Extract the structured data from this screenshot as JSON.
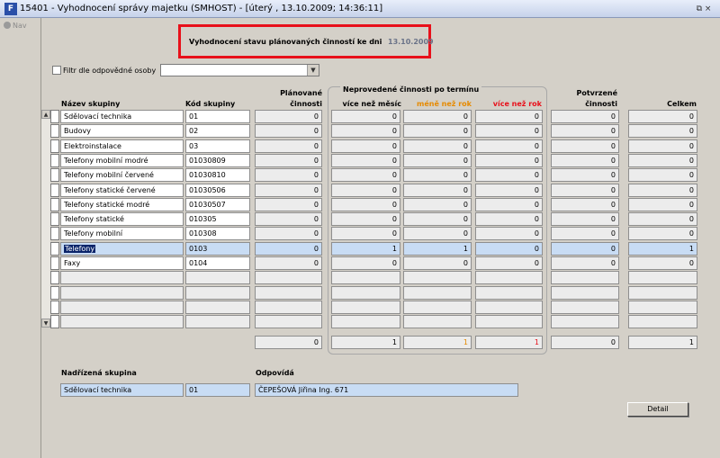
{
  "window": {
    "icon_label": "F",
    "title": "15401 - Vyhodnocení správy majetku (SMHOST) - [úterý , 13.10.2009; 14:36:11]",
    "restore_glyph": "⧉ ×"
  },
  "nav": {
    "label": "Nav"
  },
  "header": {
    "title": "Vyhodnocení stavu plánovaných činností ke dni",
    "date": "13.10.2009"
  },
  "filter": {
    "label": "Filtr dle odpovědné osoby",
    "value": ""
  },
  "columns": {
    "name": "Název skupiny",
    "code": "Kód skupiny",
    "planned_line1": "Plánované",
    "planned_line2": "činnosti",
    "overdue_group": "Neprovedené činnosti po termínu",
    "over_month": "více než měsíc",
    "under_year": "méně než rok",
    "over_year": "více než rok",
    "confirmed_line1": "Potvrzené",
    "confirmed_line2": "činnosti",
    "total": "Celkem"
  },
  "colors": {
    "under_year": "#e68a00",
    "over_year": "#e8101a",
    "highlight": "#c8dcf4",
    "frame": "#e8101a"
  },
  "rows": [
    {
      "name": "Sdělovací technika",
      "code": "01",
      "planned": "0",
      "over_month": "0",
      "under_year": "0",
      "over_year": "0",
      "confirmed": "0",
      "total": "0"
    },
    {
      "name": "Budovy",
      "code": "02",
      "planned": "0",
      "over_month": "0",
      "under_year": "0",
      "over_year": "0",
      "confirmed": "0",
      "total": "0"
    },
    {
      "name": "Elektroinstalace",
      "code": "03",
      "planned": "0",
      "over_month": "0",
      "under_year": "0",
      "over_year": "0",
      "confirmed": "0",
      "total": "0"
    },
    {
      "name": "Telefony mobilní modré",
      "code": "01030809",
      "planned": "0",
      "over_month": "0",
      "under_year": "0",
      "over_year": "0",
      "confirmed": "0",
      "total": "0"
    },
    {
      "name": "Telefony mobilní červené",
      "code": "01030810",
      "planned": "0",
      "over_month": "0",
      "under_year": "0",
      "over_year": "0",
      "confirmed": "0",
      "total": "0"
    },
    {
      "name": "Telefony statické červené",
      "code": "01030506",
      "planned": "0",
      "over_month": "0",
      "under_year": "0",
      "over_year": "0",
      "confirmed": "0",
      "total": "0"
    },
    {
      "name": "Telefony statické modré",
      "code": "01030507",
      "planned": "0",
      "over_month": "0",
      "under_year": "0",
      "over_year": "0",
      "confirmed": "0",
      "total": "0"
    },
    {
      "name": "Telefony statické",
      "code": "010305",
      "planned": "0",
      "over_month": "0",
      "under_year": "0",
      "over_year": "0",
      "confirmed": "0",
      "total": "0"
    },
    {
      "name": "Telefony mobilní",
      "code": "010308",
      "planned": "0",
      "over_month": "0",
      "under_year": "0",
      "over_year": "0",
      "confirmed": "0",
      "total": "0"
    },
    {
      "name": "Telefony",
      "code": "0103",
      "planned": "0",
      "over_month": "1",
      "under_year": "1",
      "over_year": "0",
      "confirmed": "0",
      "total": "1"
    },
    {
      "name": "Faxy",
      "code": "0104",
      "planned": "0",
      "over_month": "0",
      "under_year": "0",
      "over_year": "0",
      "confirmed": "0",
      "total": "0"
    }
  ],
  "totals": {
    "planned": "0",
    "over_month": "1",
    "under_year": "1",
    "over_year": "1",
    "confirmed": "0",
    "total": "1"
  },
  "footer": {
    "parent_label": "Nadřízená skupina",
    "parent_name": "Sdělovací technika",
    "parent_code": "01",
    "responsible_label": "Odpovídá",
    "responsible_value": "ČEPEŠOVÁ Jiřina Ing. 671",
    "detail_button": "Detail"
  }
}
